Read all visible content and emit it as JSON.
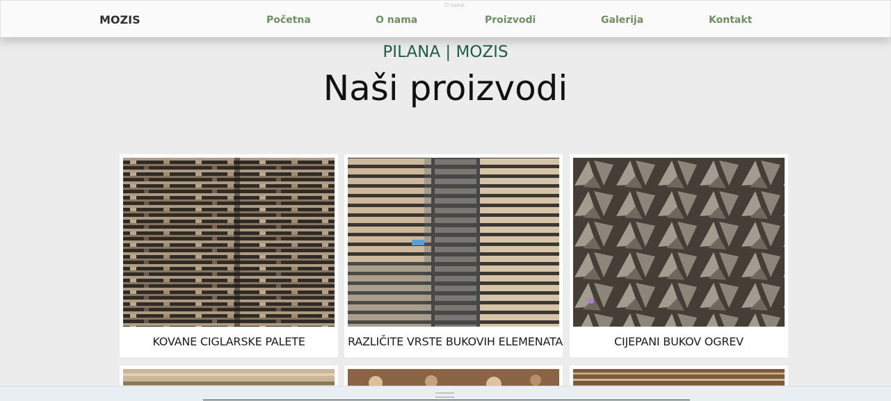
{
  "nav": {
    "brand": "MOZIS",
    "tooltip": "O nama",
    "items": [
      {
        "label": "Početna"
      },
      {
        "label": "O nama"
      },
      {
        "label": "Proizvodi"
      },
      {
        "label": "Galerija"
      },
      {
        "label": "Kontakt"
      }
    ]
  },
  "hero": {
    "subtitle": "PILANA | MOZIS",
    "title": "Naši proizvodi"
  },
  "products": [
    {
      "label": "KOVANE CIGLARSKE PALETE",
      "image": "pallet-stack-photo"
    },
    {
      "label": "RAZLIČITE VRSTE BUKOVIH ELEMENATA",
      "image": "beech-boards-photo"
    },
    {
      "label": "CIJEPANI BUKOV OGREV",
      "image": "split-firewood-photo"
    }
  ],
  "colors": {
    "nav_link": "#6f8f63",
    "subtitle": "#1f5b4a",
    "background": "#ececec"
  }
}
